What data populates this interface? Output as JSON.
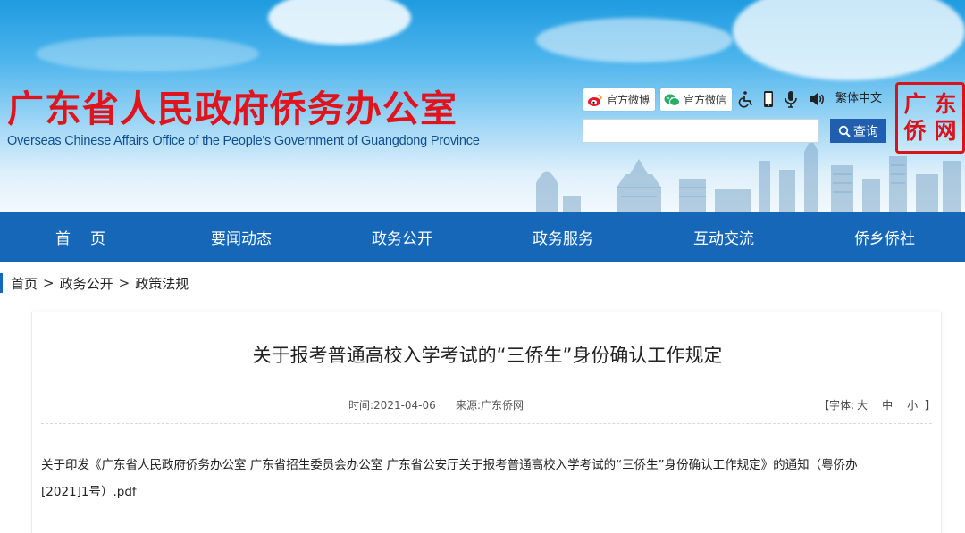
{
  "header": {
    "title": "广东省人民政府侨务办公室",
    "subtitle": "Overseas Chinese Affairs Office of the People's Government of Guangdong Province",
    "weibo_label": "官方微博",
    "wechat_label": "官方微信",
    "lang_label": "繁体中文",
    "search_placeholder": "",
    "search_button": "查询",
    "seal_chars": [
      "广",
      "东",
      "侨",
      "网"
    ],
    "colors": {
      "title": "#e0141d",
      "nav": "#1667b8",
      "search_btn": "#1f5fae"
    }
  },
  "nav": {
    "items": [
      "首页",
      "要闻动态",
      "政务公开",
      "政务服务",
      "互动交流",
      "侨乡侨社"
    ]
  },
  "breadcrumb": {
    "items": [
      "首页",
      "政务公开",
      "政策法规"
    ],
    "separator": ">"
  },
  "article": {
    "title": "关于报考普通高校入学考试的“三侨生”身份确认工作规定",
    "time_label": "时间:2021-04-06",
    "source_label": "来源:广东侨网",
    "font_prefix": "【字体:",
    "font_sizes": [
      "大",
      "中",
      "小"
    ],
    "font_suffix": "】",
    "attachment_line1": "关于印发《广东省人民政府侨务办公室 广东省招生委员会办公室 广东省公安厅关于报考普通高校入学考试的“三侨生”身份确认工作规定》的通知（粤侨办",
    "attachment_line2": "[2021]1号）.pdf"
  }
}
